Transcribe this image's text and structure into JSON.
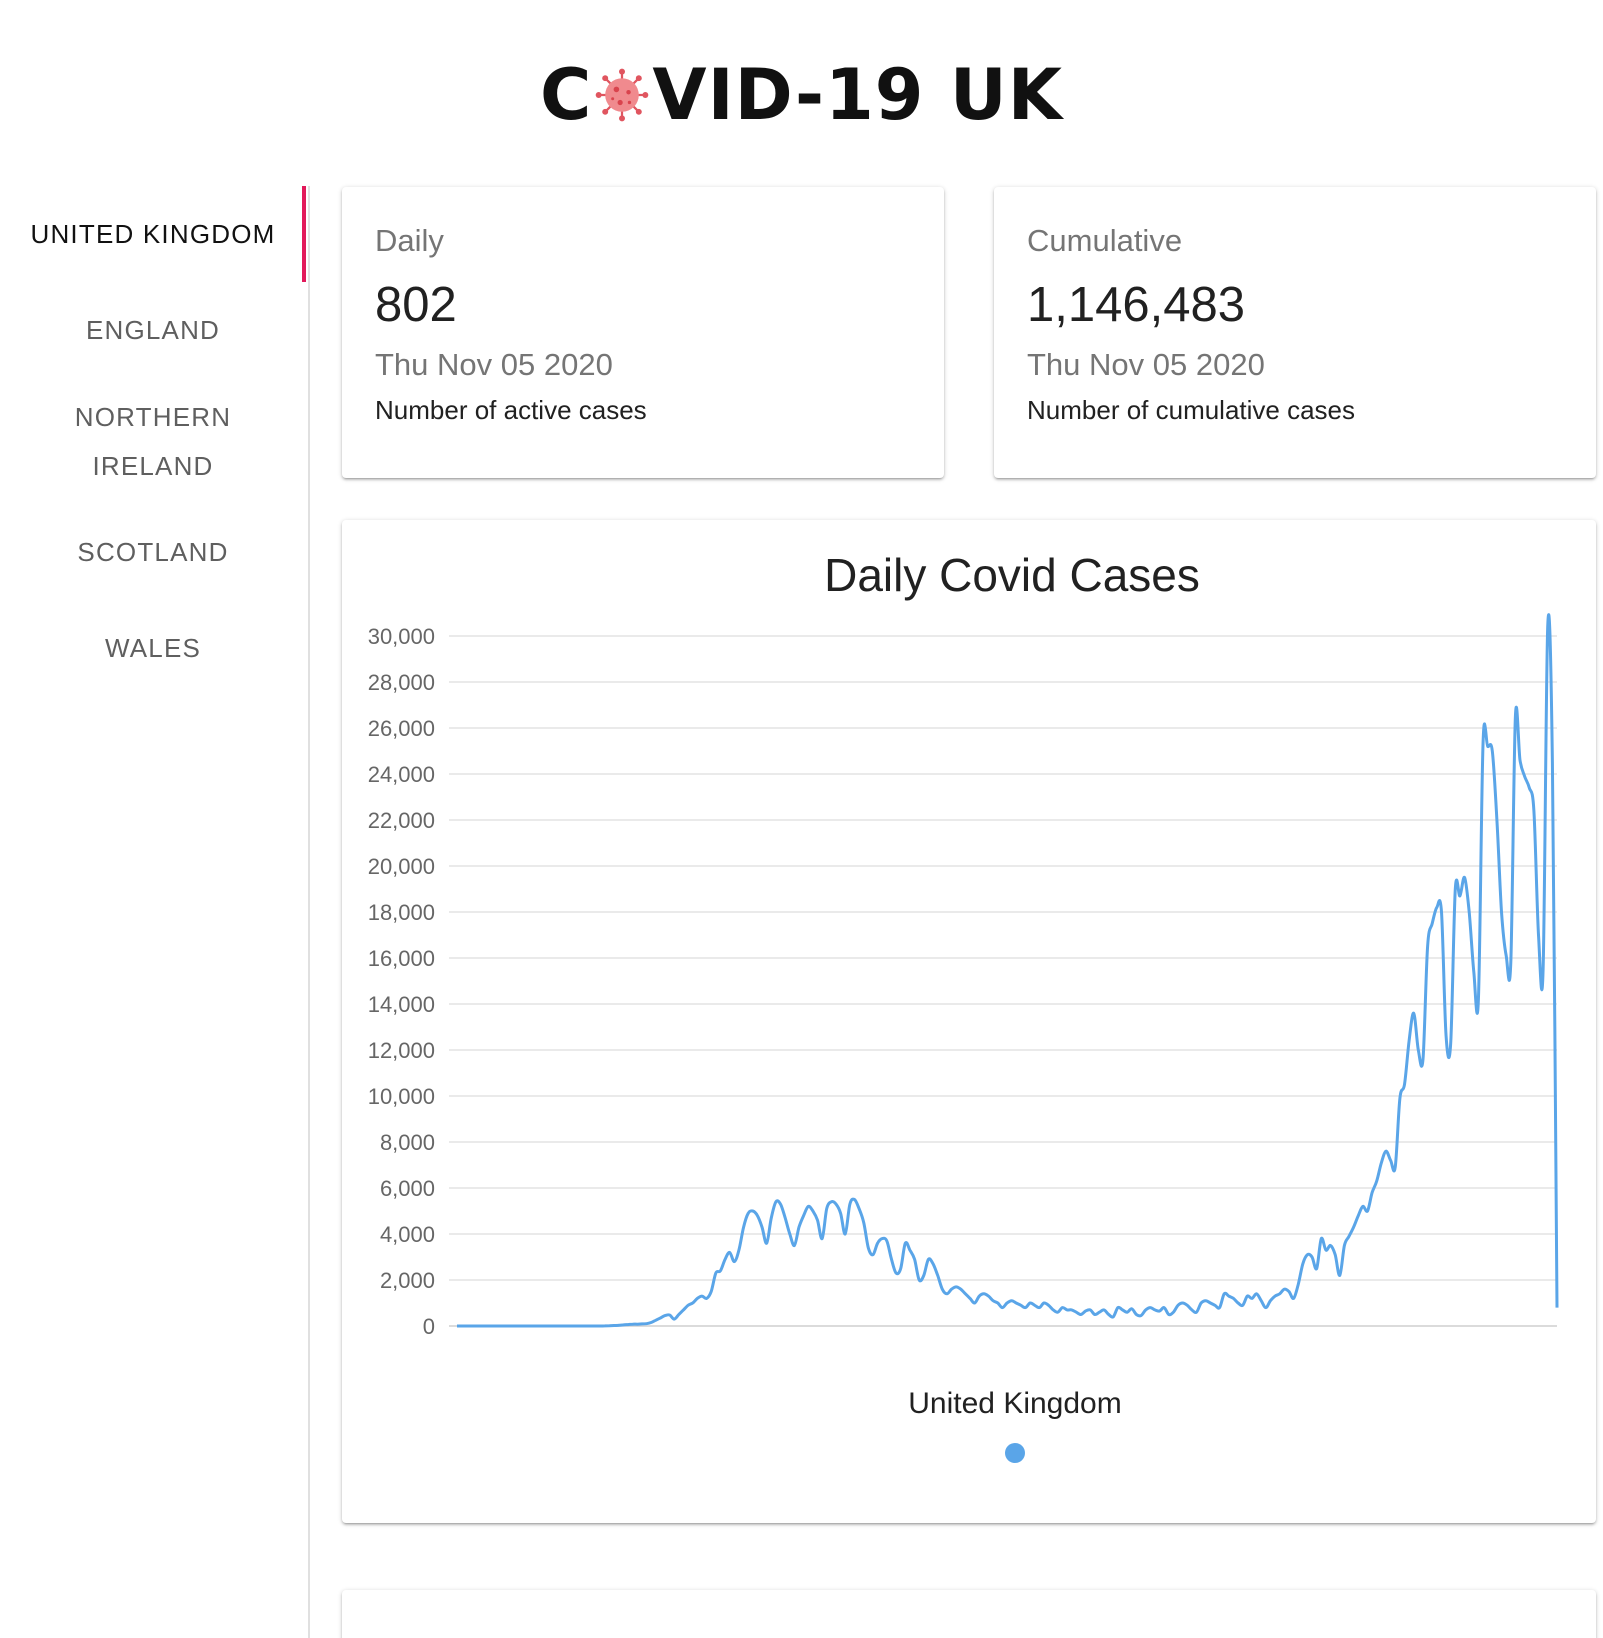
{
  "header": {
    "title_prefix": "C",
    "title_suffix": "VID-19 UK"
  },
  "sidebar": {
    "tabs": [
      {
        "label": "UNITED KINGDOM",
        "active": true
      },
      {
        "label": "ENGLAND",
        "active": false
      },
      {
        "label": "NORTHERN IRELAND",
        "active": false
      },
      {
        "label": "SCOTLAND",
        "active": false
      },
      {
        "label": "WALES",
        "active": false
      }
    ],
    "accent_color": "#e2195a"
  },
  "cards": {
    "daily": {
      "title": "Daily",
      "value": "802",
      "date": "Thu Nov 05 2020",
      "description": "Number of active cases"
    },
    "cumulative": {
      "title": "Cumulative",
      "value": "1,146,483",
      "date": "Thu Nov 05 2020",
      "description": "Number of cumulative cases"
    }
  },
  "chart_data": {
    "type": "line",
    "title": "Daily Covid Cases",
    "xlabel": "",
    "ylabel": "",
    "ylim": [
      0,
      30000
    ],
    "yticks": [
      0,
      2000,
      4000,
      6000,
      8000,
      10000,
      12000,
      14000,
      16000,
      18000,
      20000,
      22000,
      24000,
      26000,
      28000,
      30000
    ],
    "ytick_labels": [
      "0",
      "2,000",
      "4,000",
      "6,000",
      "8,000",
      "10,000",
      "12,000",
      "14,000",
      "16,000",
      "18,000",
      "20,000",
      "22,000",
      "24,000",
      "26,000",
      "28,000",
      "30,000"
    ],
    "grid": true,
    "legend_position": "bottom",
    "series": [
      {
        "name": "United Kingdom",
        "color": "#5aa5e8",
        "values": [
          0,
          0,
          0,
          0,
          0,
          0,
          0,
          0,
          0,
          0,
          0,
          0,
          0,
          0,
          0,
          0,
          0,
          0,
          0,
          0,
          0,
          0,
          0,
          0,
          0,
          0,
          0,
          0,
          0,
          0,
          0,
          0,
          5,
          10,
          20,
          30,
          50,
          60,
          80,
          80,
          90,
          100,
          150,
          250,
          350,
          450,
          480,
          300,
          500,
          700,
          900,
          1000,
          1200,
          1300,
          1200,
          1500,
          2300,
          2400,
          2900,
          3200,
          2800,
          3300,
          4300,
          4900,
          5000,
          4800,
          4300,
          3600,
          4700,
          5400,
          5300,
          4700,
          4000,
          3500,
          4300,
          4800,
          5200,
          5000,
          4600,
          3800,
          5100,
          5400,
          5300,
          4900,
          4000,
          5300,
          5500,
          5100,
          4500,
          3400,
          3100,
          3600,
          3800,
          3700,
          2900,
          2300,
          2500,
          3600,
          3300,
          2900,
          2000,
          2200,
          2900,
          2700,
          2200,
          1600,
          1400,
          1600,
          1700,
          1600,
          1400,
          1200,
          1000,
          1300,
          1400,
          1300,
          1100,
          1000,
          800,
          1000,
          1100,
          1000,
          900,
          800,
          1000,
          900,
          800,
          1000,
          900,
          700,
          600,
          800,
          700,
          700,
          600,
          500,
          650,
          700,
          500,
          600,
          700,
          500,
          400,
          800,
          700,
          600,
          750,
          500,
          450,
          700,
          800,
          700,
          650,
          800,
          500,
          600,
          900,
          1000,
          900,
          700,
          600,
          1000,
          1100,
          1000,
          900,
          800,
          1400,
          1300,
          1200,
          1000,
          900,
          1300,
          1200,
          1400,
          1100,
          800,
          1100,
          1300,
          1400,
          1600,
          1500,
          1200,
          1800,
          2700,
          3100,
          3000,
          2500,
          3800,
          3300,
          3500,
          3100,
          2200,
          3500,
          3900,
          4300,
          4800,
          5200,
          5000,
          5800,
          6300,
          7100,
          7600,
          7200,
          6900,
          9900,
          10500,
          12400,
          13600,
          12000,
          11600,
          16500,
          17500,
          18200,
          18000,
          12600,
          12300,
          19000,
          18700,
          19500,
          18000,
          15400,
          14200,
          25400,
          25200,
          25000,
          22000,
          18000,
          16100,
          15800,
          26500,
          24600,
          23900,
          23400,
          22400,
          17000,
          15500,
          30500,
          24500,
          802
        ]
      }
    ]
  }
}
